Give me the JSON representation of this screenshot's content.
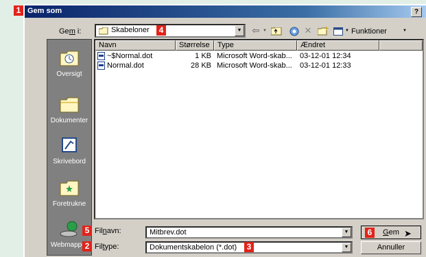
{
  "markers": {
    "title": "1",
    "filetype": "2",
    "filetype_value": "3",
    "location": "4",
    "filename": "5",
    "save": "6"
  },
  "window": {
    "title": "Gem som",
    "help": "?"
  },
  "location": {
    "label_pre": "Ge",
    "label_ul": "m",
    "label_post": " i:",
    "value": "Skabeloner"
  },
  "toolbar": {
    "tools_label": "Funktioner"
  },
  "sidebar": {
    "items": [
      {
        "label": "Oversigt",
        "icon": "history-icon"
      },
      {
        "label": "Dokumenter",
        "icon": "my-documents-folder-icon"
      },
      {
        "label": "Skrivebord",
        "icon": "desktop-icon"
      },
      {
        "label": "Foretrukne",
        "icon": "favorites-icon"
      },
      {
        "label": "Webmapper",
        "icon": "web-folders-icon"
      }
    ]
  },
  "columns": [
    "Navn",
    "Størrelse",
    "Type",
    "Ændret"
  ],
  "files": [
    {
      "name": "~$Normal.dot",
      "size": "1 KB",
      "type": "Microsoft Word-skab...",
      "modified": "03-12-01 12:34"
    },
    {
      "name": "Normal.dot",
      "size": "28 KB",
      "type": "Microsoft Word-skab...",
      "modified": "03-12-01 12:33"
    }
  ],
  "filename": {
    "label_pre": "Fil",
    "label_ul": "n",
    "label_post": "avn:",
    "value": "Mitbrev.dot"
  },
  "filetype": {
    "label_pre": "Fil",
    "label_ul": "t",
    "label_post": "ype:",
    "value": "Dokumentskabelon (*.dot)"
  },
  "buttons": {
    "save_ul": "G",
    "save_post": "em",
    "cancel": "Annuller"
  },
  "colors": {
    "marker": "#e2231a",
    "titlebar": "#0a246a",
    "dialog": "#d4d0c8",
    "background": "#e2efe6"
  }
}
